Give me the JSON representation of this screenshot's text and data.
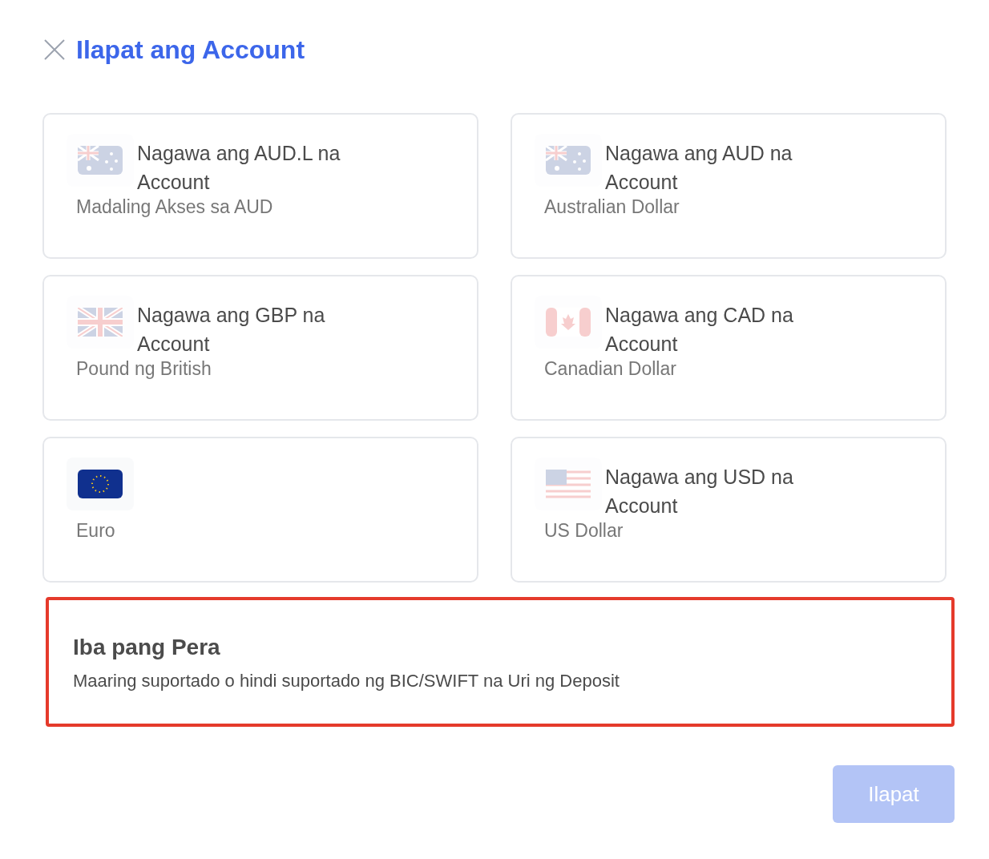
{
  "dialog": {
    "title": "Ilapat ang Account"
  },
  "options": [
    {
      "kind": "au",
      "title": "Nagawa ang AUD.L na Account",
      "subtitle": "Madaling Akses sa AUD",
      "disabled": true
    },
    {
      "kind": "gb",
      "title": "Nagawa ang GBP na Account",
      "subtitle": "Pound ng British",
      "disabled": true
    },
    {
      "kind": "eu",
      "subtitle": "Euro",
      "disabled": false
    },
    {
      "kind": "au",
      "title": "Nagawa ang AUD na Account",
      "subtitle": "Australian Dollar",
      "disabled": true
    },
    {
      "kind": "ca",
      "title": "Nagawa ang CAD na Account",
      "subtitle": "Canadian Dollar",
      "disabled": true
    },
    {
      "kind": "us",
      "title": "Nagawa ang USD na Account",
      "subtitle": "US Dollar",
      "disabled": true
    }
  ],
  "other": {
    "title": "Iba pang Pera",
    "description": "Maaring suportado o hindi suportado ng BIC/SWIFT na Uri ng Deposit",
    "selected": true
  },
  "apply_button": {
    "label": "Ilapat",
    "disabled": true
  }
}
